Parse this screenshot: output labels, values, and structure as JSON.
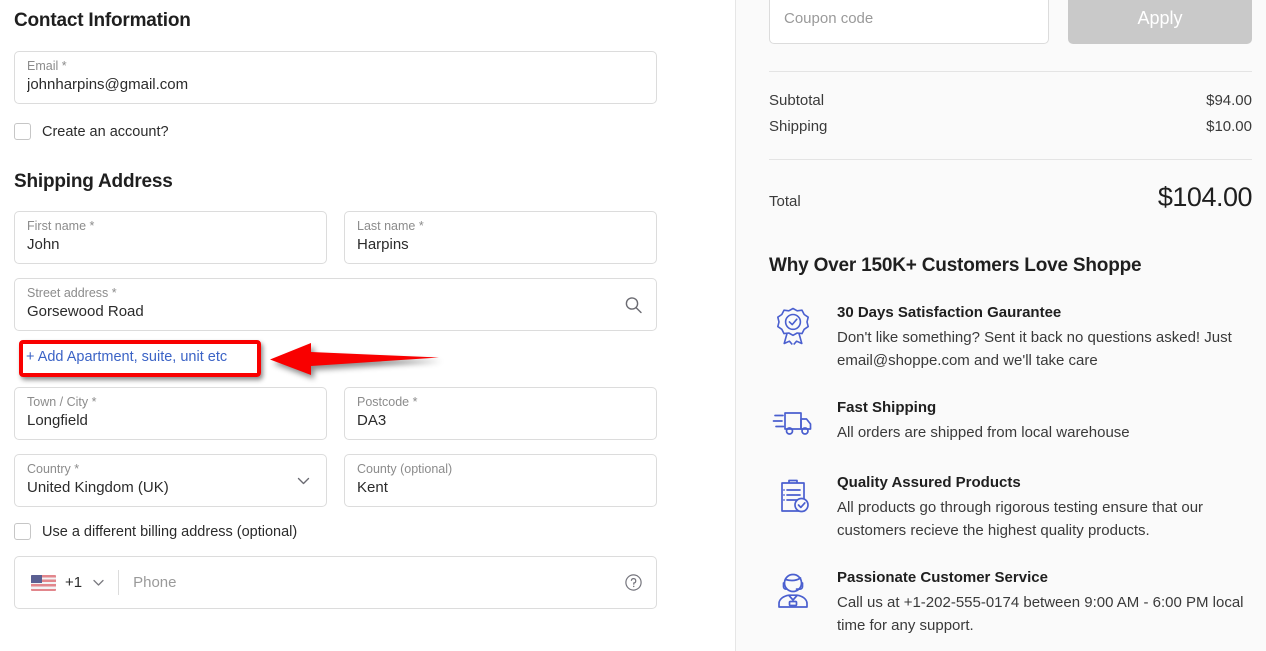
{
  "checkout": {
    "contact": {
      "title": "Contact Information",
      "email": {
        "label": "Email *",
        "value": "johnharpins@gmail.com",
        "placeholder": "Email"
      },
      "create_account_label": "Create an account?"
    },
    "shipping": {
      "title": "Shipping Address",
      "first_name": {
        "label": "First name *",
        "value": "John",
        "placeholder": "First name"
      },
      "last_name": {
        "label": "Last name *",
        "value": "Harpins",
        "placeholder": "Last name"
      },
      "street": {
        "label": "Street address *",
        "value": "Gorsewood Road",
        "placeholder": "Street address"
      },
      "street_search_icon": "search-icon",
      "add_apartment_label": "+ Add Apartment, suite, unit etc",
      "city": {
        "label": "Town / City *",
        "value": "Longfield",
        "placeholder": "Town / City"
      },
      "postcode": {
        "label": "Postcode *",
        "value": "DA3",
        "placeholder": "Postcode"
      },
      "country": {
        "label": "Country *",
        "value": "United Kingdom (UK)",
        "caret_icon": "chevron-down-icon"
      },
      "county": {
        "label": "County (optional)",
        "value": "Kent",
        "placeholder": "County"
      },
      "billing_address_label": "Use a different billing address (optional)",
      "phone": {
        "flag_icon": "us-flag-icon",
        "dial_code": "+1",
        "caret_icon": "chevron-down-icon",
        "placeholder": "Phone",
        "value": "",
        "help_icon": "question-circle-icon"
      }
    },
    "summary": {
      "coupon": {
        "placeholder": "Coupon code",
        "value": ""
      },
      "apply_label": "Apply",
      "rows": [
        {
          "label": "Subtotal",
          "value": "$94.00"
        },
        {
          "label": "Shipping",
          "value": "$10.00"
        }
      ],
      "total": {
        "label": "Total",
        "value": "$104.00"
      }
    },
    "why": {
      "title": "Why Over 150K+ Customers Love Shoppe",
      "benefits": [
        {
          "icon": "award-badge-icon",
          "title": "30 Days Satisfaction Gaurantee",
          "desc": "Don't like something? Sent it back no questions asked! Just email@shoppe.com and we'll take care"
        },
        {
          "icon": "delivery-truck-icon",
          "title": "Fast Shipping",
          "desc": "All orders are shipped from local warehouse"
        },
        {
          "icon": "clipboard-check-icon",
          "title": "Quality Assured Products",
          "desc": "All products go through rigorous testing ensure that our customers recieve the highest quality products."
        },
        {
          "icon": "headset-agent-icon",
          "title": "Passionate Customer Service",
          "desc": "Call us at +1-202-555-0174 between 9:00 AM - 6:00 PM local time for any support."
        }
      ]
    },
    "annotation": {
      "highlight_color": "#f90000",
      "target": "add-apartment-link"
    }
  }
}
